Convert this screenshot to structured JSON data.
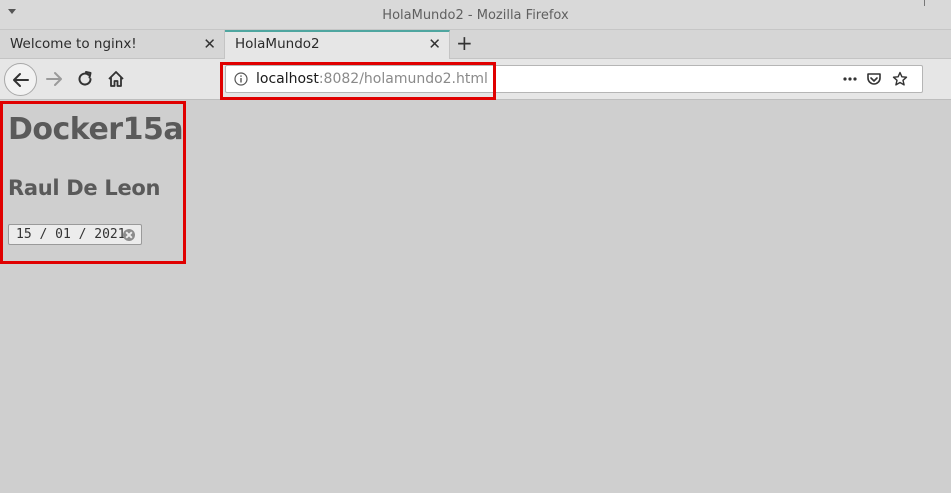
{
  "window": {
    "title": "HolaMundo2 - Mozilla Firefox"
  },
  "tabs": [
    {
      "label": "Welcome to nginx!",
      "active": false
    },
    {
      "label": "HolaMundo2",
      "active": true
    }
  ],
  "tab_close_glyph": "✕",
  "new_tab_glyph": "+",
  "urlbar": {
    "host": "localhost",
    "path": ":8082/holamundo2.html"
  },
  "icons": {
    "menu": "chevron-down-icon",
    "back": "arrow-left-icon",
    "forward": "arrow-right-icon",
    "reload": "reload-icon",
    "home": "home-icon",
    "info": "info-icon",
    "more": "more-icon",
    "pocket": "pocket-icon",
    "bookmark": "star-icon",
    "clear": "clear-icon"
  },
  "page": {
    "heading": "Docker15a",
    "subheading": "Raul De Leon",
    "date_value": "15 / 01 / 2021"
  },
  "colors": {
    "accent_tab": "#4fa6a0",
    "highlight": "#e00000",
    "page_background": "#cfcfcf"
  }
}
